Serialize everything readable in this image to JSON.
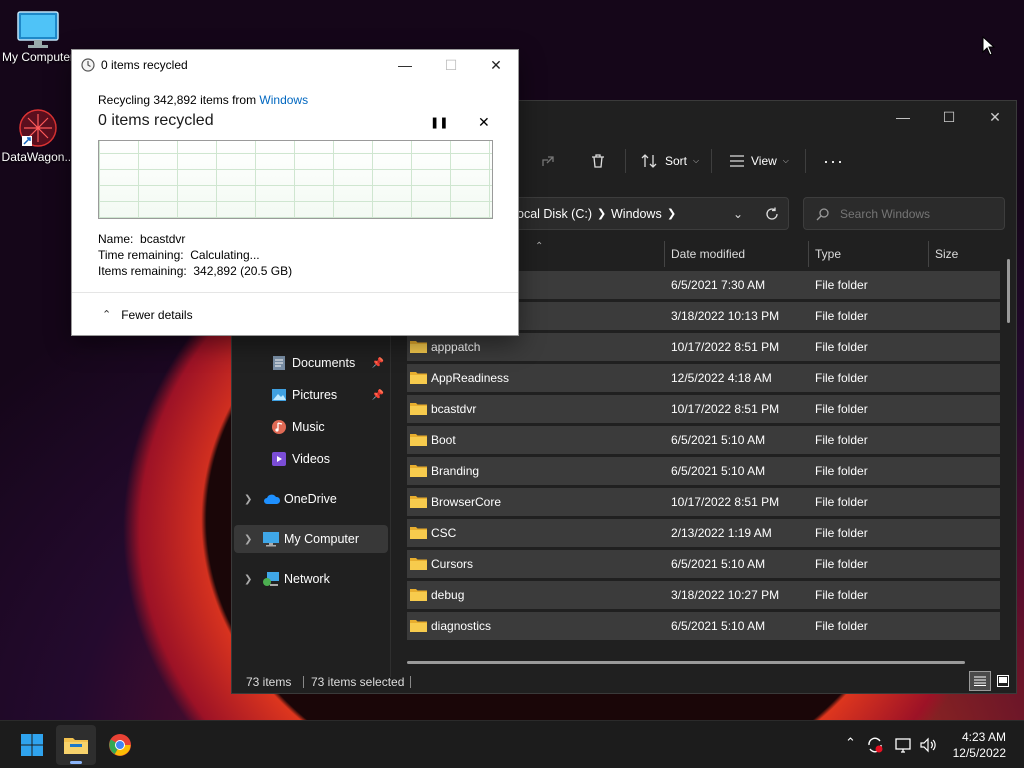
{
  "desktop": {
    "icons": [
      {
        "label": "My Computer"
      },
      {
        "label": "DataWagon..."
      }
    ]
  },
  "dialog": {
    "title": "0 items recycled",
    "recycling_prefix": "Recycling 342,892 items from ",
    "recycling_source": "Windows",
    "heading": "0 items recycled",
    "details": {
      "name_label": "Name:",
      "name_value": "bcastdvr",
      "time_label": "Time remaining:",
      "time_value": "Calculating...",
      "items_label": "Items remaining:",
      "items_value": "342,892 (20.5 GB)"
    },
    "footer_label": "Fewer details"
  },
  "explorer": {
    "toolbar": {
      "sort_label": "Sort",
      "view_label": "View"
    },
    "address": {
      "part1": "ocal Disk (C:)",
      "part2": "Windows"
    },
    "search": {
      "placeholder": "Search Windows"
    },
    "columns": {
      "date": "Date modified",
      "type": "Type",
      "size": "Size"
    },
    "nav": [
      {
        "label": "Documents",
        "pinned": true
      },
      {
        "label": "Pictures",
        "pinned": true
      },
      {
        "label": "Music"
      },
      {
        "label": "Videos"
      },
      {
        "label": "OneDrive"
      },
      {
        "label": "My Computer"
      },
      {
        "label": "Network"
      }
    ],
    "rows": [
      {
        "name": "",
        "date": "6/5/2021 7:30 AM",
        "type": "File folder"
      },
      {
        "name": "",
        "date": "3/18/2022 10:13 PM",
        "type": "File folder"
      },
      {
        "name": "apppatch",
        "date": "10/17/2022 8:51 PM",
        "type": "File folder"
      },
      {
        "name": "AppReadiness",
        "date": "12/5/2022 4:18 AM",
        "type": "File folder"
      },
      {
        "name": "bcastdvr",
        "date": "10/17/2022 8:51 PM",
        "type": "File folder"
      },
      {
        "name": "Boot",
        "date": "6/5/2021 5:10 AM",
        "type": "File folder"
      },
      {
        "name": "Branding",
        "date": "6/5/2021 5:10 AM",
        "type": "File folder"
      },
      {
        "name": "BrowserCore",
        "date": "10/17/2022 8:51 PM",
        "type": "File folder"
      },
      {
        "name": "CSC",
        "date": "2/13/2022 1:19 AM",
        "type": "File folder"
      },
      {
        "name": "Cursors",
        "date": "6/5/2021 5:10 AM",
        "type": "File folder"
      },
      {
        "name": "debug",
        "date": "3/18/2022 10:27 PM",
        "type": "File folder"
      },
      {
        "name": "diagnostics",
        "date": "6/5/2021 5:10 AM",
        "type": "File folder"
      }
    ],
    "status": {
      "items": "73 items",
      "selected": "73 items selected"
    }
  },
  "taskbar": {
    "time": "4:23 AM",
    "date": "12/5/2022"
  },
  "colors": {
    "folder": "#f2c14e",
    "link": "#0067c0",
    "accent": "#0078d4"
  }
}
